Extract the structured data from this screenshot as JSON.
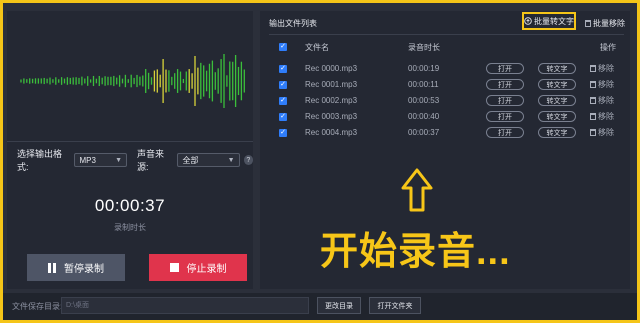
{
  "left": {
    "format_label": "选择输出格式:",
    "format_value": "MP3",
    "source_label": "声音来源:",
    "source_value": "全部",
    "help_glyph": "?",
    "timer": "00:00:37",
    "timer_label": "录制时长",
    "pause_label": "暂停录制",
    "stop_label": "停止录制"
  },
  "right": {
    "title": "输出文件列表",
    "batch_convert": "批量转文字",
    "batch_remove": "批量移除",
    "headers": {
      "name": "文件名",
      "duration": "录音时长",
      "action": "操作"
    },
    "rows": [
      {
        "name": "Rec 0000.mp3",
        "duration": "00:00:19",
        "open": "打开",
        "convert": "转文字",
        "remove": "移除"
      },
      {
        "name": "Rec 0001.mp3",
        "duration": "00:00:11",
        "open": "打开",
        "convert": "转文字",
        "remove": "移除"
      },
      {
        "name": "Rec 0002.mp3",
        "duration": "00:00:53",
        "open": "打开",
        "convert": "转文字",
        "remove": "移除"
      },
      {
        "name": "Rec 0003.mp3",
        "duration": "00:00:40",
        "open": "打开",
        "convert": "转文字",
        "remove": "移除"
      },
      {
        "name": "Rec 0004.mp3",
        "duration": "00:00:37",
        "open": "打开",
        "convert": "转文字",
        "remove": "移除"
      }
    ],
    "overlay_text": "开始录音..."
  },
  "bottom": {
    "save_dir_label": "文件保存目录:",
    "save_dir_value": "D:\\桌面",
    "change_dir": "更改目录",
    "open_folder": "打开文件夹"
  },
  "colors": {
    "accent_yellow": "#f5c518",
    "stop_red": "#e0344c",
    "checkbox_blue": "#2f7dfa",
    "wave_green": "#3bbf3b"
  }
}
